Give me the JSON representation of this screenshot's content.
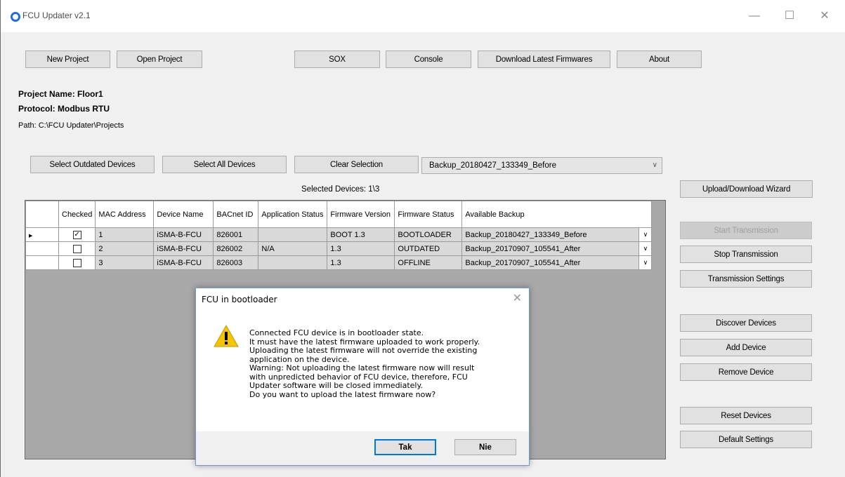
{
  "window": {
    "title": "FCU Updater v2.1"
  },
  "toolbar": {
    "new_project": "New Project",
    "open_project": "Open Project",
    "sox": "SOX",
    "console": "Console",
    "download_firmwares": "Download Latest Firmwares",
    "about": "About"
  },
  "project": {
    "name": "Project Name: Floor1",
    "protocol": "Protocol: Modbus RTU",
    "path": "Path: C:\\FCU Updater\\Projects"
  },
  "selection": {
    "select_outdated": "Select Outdated Devices",
    "select_all": "Select All Devices",
    "clear": "Clear Selection",
    "backup_combo": "Backup_20180427_133349_Before",
    "selected_count": "Selected Devices: 1\\3"
  },
  "grid": {
    "headers": [
      "Checked",
      "MAC Address",
      "Device Name",
      "BACnet ID",
      "Application Status",
      "Firmware Version",
      "Firmware Status",
      "Available Backup"
    ],
    "rows": [
      {
        "checked": true,
        "mac": "1",
        "device": "iSMA-B-FCU",
        "bacnet": "826001",
        "app_status": "",
        "fw_version": "BOOT 1.3",
        "fw_status": "BOOTLOADER",
        "backup": "Backup_20180427_133349_Before"
      },
      {
        "checked": false,
        "mac": "2",
        "device": "iSMA-B-FCU",
        "bacnet": "826002",
        "app_status": "N/A",
        "fw_version": "1.3",
        "fw_status": "OUTDATED",
        "backup": "Backup_20170907_105541_After"
      },
      {
        "checked": false,
        "mac": "3",
        "device": "iSMA-B-FCU",
        "bacnet": "826003",
        "app_status": "",
        "fw_version": "1.3",
        "fw_status": "OFFLINE",
        "backup": "Backup_20170907_105541_After"
      }
    ]
  },
  "side": {
    "wizard": "Upload/Download Wizard",
    "start": "Start Transmission",
    "stop": "Stop Transmission",
    "settings": "Transmission Settings",
    "discover": "Discover Devices",
    "add": "Add Device",
    "remove": "Remove Device",
    "reset": "Reset Devices",
    "defaults": "Default Settings"
  },
  "dialog": {
    "title": "FCU in bootloader",
    "lines": [
      "Connected FCU device is in bootloader state.",
      "It must have the latest firmware uploaded to work properly.",
      "Uploading the latest firmware will not override the existing",
      "application on the device.",
      "Warning: Not uploading the latest firmware now will result",
      "with unpredicted behavior of FCU device, therefore, FCU",
      "Updater software will be closed immediately.",
      "Do you want to upload the latest firmware now?"
    ],
    "yes": "Tak",
    "no": "Nie"
  },
  "icons": {
    "app": "app-globe-icon",
    "warning": "warning-triangle-icon",
    "dropdown": "chevron-down-icon",
    "row_pointer": "row-pointer-icon"
  },
  "colors": {
    "warning_fill": "#f5c400",
    "default_button_border": "#0078d7",
    "grid_background": "#a8a8a8"
  }
}
